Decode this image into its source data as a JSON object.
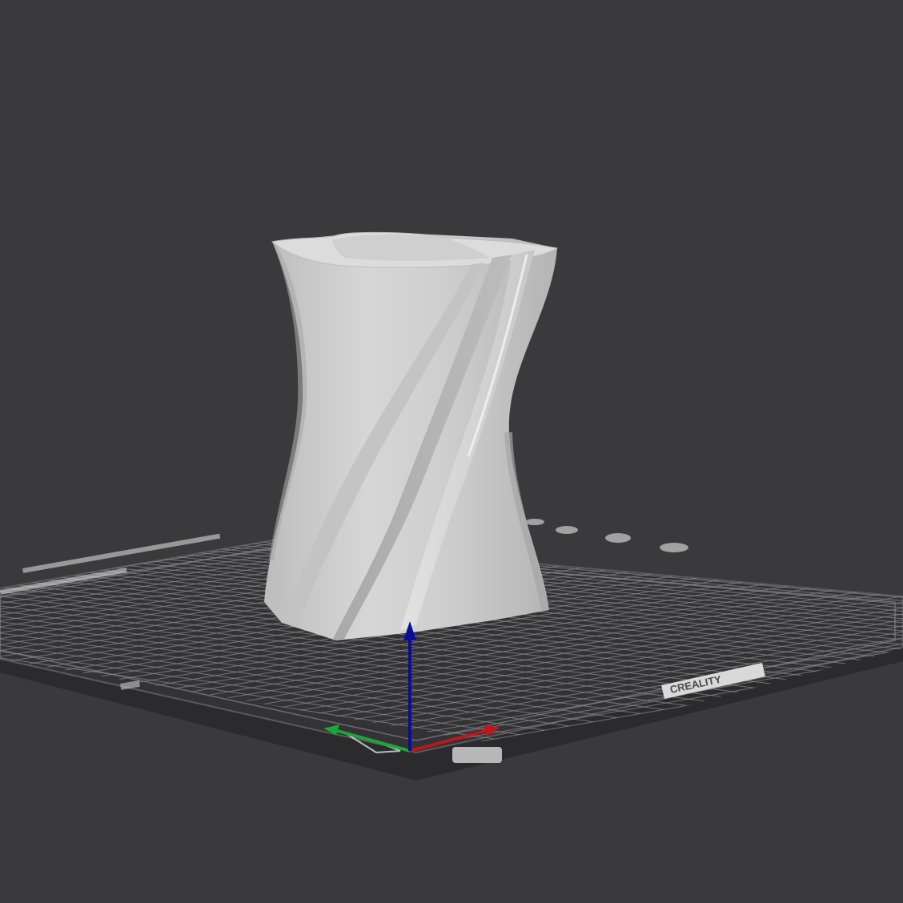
{
  "viewport": {
    "background": "#3a3a3c",
    "bed": {
      "brand_label": "CREALITY",
      "corner_label": "",
      "plate_color": "#343436",
      "grid_color": "#8a8a8c",
      "edge_color": "#5a5a5e"
    },
    "model": {
      "name": "twisted-vase",
      "color": "#c9c9c9"
    },
    "axes": {
      "x_color": "#c0161a",
      "y_color": "#1aa63a",
      "z_color": "#0c0c9a"
    }
  }
}
